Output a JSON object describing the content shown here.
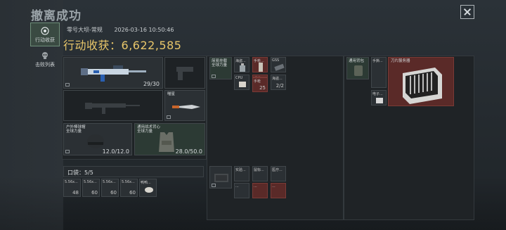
{
  "title": "撤离成功",
  "tabs": [
    {
      "label": "行动收获"
    },
    {
      "label": "击败列表"
    }
  ],
  "map": "零号大坝-常规",
  "datetime": "2026-03-16 10:50:46",
  "haul": {
    "label": "行动收获：",
    "value": "6,622,585"
  },
  "weapon_primary": {
    "ammo": "29/30"
  },
  "melee": {
    "label": "喵星"
  },
  "helmet": {
    "label": "户外棒球帽",
    "sub": "全球力量",
    "durability": "12.0/12.0"
  },
  "armor": {
    "label": "通用战术背心",
    "sub": "全球力量",
    "durability": "28.0/50.0"
  },
  "rig_items": [
    {
      "label": "简易挂载",
      "sub": "全球力量"
    },
    {
      "label": "海盗..."
    },
    {
      "label": "手枪..."
    },
    {
      "label": "GSS"
    },
    {
      "label": "CPU",
      "count": ""
    },
    {
      "label": "手枪",
      "count": "90"
    },
    {
      "label": "手枪",
      "count": "25"
    },
    {
      "label": "海盗...",
      "count": "2/2"
    }
  ],
  "backpack": {
    "label": "通用背包"
  },
  "case_items": [
    {
      "label": "手撕..."
    },
    {
      "label": "刀片服务器"
    },
    {
      "label": "电子..."
    }
  ],
  "pocket": {
    "label": "口袋：5/5"
  },
  "pocket_items": [
    {
      "label": "5.56x...",
      "count": "48"
    },
    {
      "label": "5.56x...",
      "count": "60"
    },
    {
      "label": "5.56x...",
      "count": "60"
    },
    {
      "label": "5.56x...",
      "count": "60"
    },
    {
      "label": "鸭鸭..."
    }
  ],
  "safebox_items": [
    {
      "label": "实验..."
    },
    {
      "label": "鼠标..."
    },
    {
      "label": "医疗..."
    },
    {
      "label": "..."
    },
    {
      "label": "..."
    },
    {
      "label": "..."
    }
  ]
}
